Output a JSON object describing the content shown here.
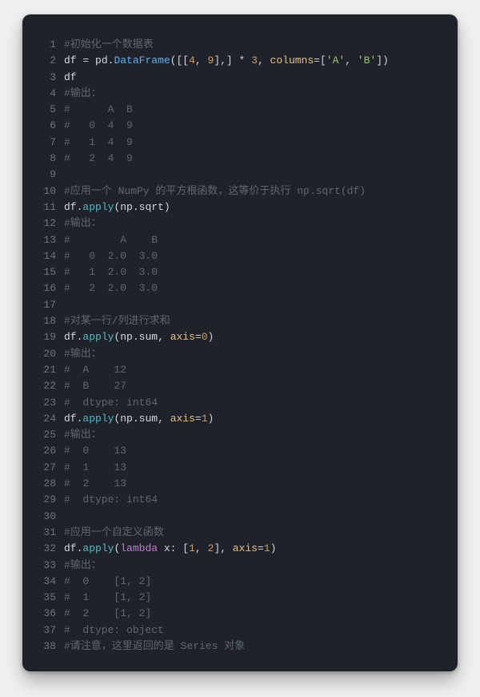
{
  "theme": {
    "background": "#1f2329",
    "gutter": "#6c7380",
    "foreground": "#d4d8df",
    "comment": "#5e6672",
    "function": "#61afef",
    "attribute": "#56b6c2",
    "number": "#d19a66",
    "string": "#98c379",
    "keyword": "#c678dd",
    "parameter": "#e5c07b"
  },
  "lines": [
    {
      "n": 1,
      "tokens": [
        [
          "c-comment",
          "#初始化一个数据表"
        ]
      ]
    },
    {
      "n": 2,
      "tokens": [
        [
          "c-ident",
          "df "
        ],
        [
          "c-op",
          "= "
        ],
        [
          "c-ident",
          "pd"
        ],
        [
          "c-op",
          "."
        ],
        [
          "c-func",
          "DataFrame"
        ],
        [
          "c-op",
          "([["
        ],
        [
          "c-num",
          "4"
        ],
        [
          "c-op",
          ", "
        ],
        [
          "c-num",
          "9"
        ],
        [
          "c-op",
          "],] "
        ],
        [
          "c-op",
          "* "
        ],
        [
          "c-num",
          "3"
        ],
        [
          "c-op",
          ", "
        ],
        [
          "c-param",
          "columns"
        ],
        [
          "c-op",
          "=["
        ],
        [
          "c-str",
          "'A'"
        ],
        [
          "c-op",
          ", "
        ],
        [
          "c-str",
          "'B'"
        ],
        [
          "c-op",
          "])"
        ]
      ]
    },
    {
      "n": 3,
      "tokens": [
        [
          "c-ident",
          "df"
        ]
      ]
    },
    {
      "n": 4,
      "tokens": [
        [
          "c-comment",
          "#输出："
        ]
      ]
    },
    {
      "n": 5,
      "tokens": [
        [
          "c-comment",
          "#      A  B"
        ]
      ]
    },
    {
      "n": 6,
      "tokens": [
        [
          "c-comment",
          "#   0  4  9"
        ]
      ]
    },
    {
      "n": 7,
      "tokens": [
        [
          "c-comment",
          "#   1  4  9"
        ]
      ]
    },
    {
      "n": 8,
      "tokens": [
        [
          "c-comment",
          "#   2  4  9"
        ]
      ]
    },
    {
      "n": 9,
      "tokens": []
    },
    {
      "n": 10,
      "tokens": [
        [
          "c-comment",
          "#应用一个 NumPy 的平方根函数，这等价于执行 np.sqrt(df)"
        ]
      ]
    },
    {
      "n": 11,
      "tokens": [
        [
          "c-ident",
          "df"
        ],
        [
          "c-op",
          "."
        ],
        [
          "c-attr",
          "apply"
        ],
        [
          "c-op",
          "("
        ],
        [
          "c-ident",
          "np"
        ],
        [
          "c-op",
          "."
        ],
        [
          "c-ident",
          "sqrt"
        ],
        [
          "c-op",
          ")"
        ]
      ]
    },
    {
      "n": 12,
      "tokens": [
        [
          "c-comment",
          "#输出："
        ]
      ]
    },
    {
      "n": 13,
      "tokens": [
        [
          "c-comment",
          "#        A    B"
        ]
      ]
    },
    {
      "n": 14,
      "tokens": [
        [
          "c-comment",
          "#   0  2.0  3.0"
        ]
      ]
    },
    {
      "n": 15,
      "tokens": [
        [
          "c-comment",
          "#   1  2.0  3.0"
        ]
      ]
    },
    {
      "n": 16,
      "tokens": [
        [
          "c-comment",
          "#   2  2.0  3.0"
        ]
      ]
    },
    {
      "n": 17,
      "tokens": []
    },
    {
      "n": 18,
      "tokens": [
        [
          "c-comment",
          "#对某一行/列进行求和"
        ]
      ]
    },
    {
      "n": 19,
      "tokens": [
        [
          "c-ident",
          "df"
        ],
        [
          "c-op",
          "."
        ],
        [
          "c-attr",
          "apply"
        ],
        [
          "c-op",
          "("
        ],
        [
          "c-ident",
          "np"
        ],
        [
          "c-op",
          "."
        ],
        [
          "c-ident",
          "sum"
        ],
        [
          "c-op",
          ", "
        ],
        [
          "c-param",
          "axis"
        ],
        [
          "c-op",
          "="
        ],
        [
          "c-num",
          "0"
        ],
        [
          "c-op",
          ")"
        ]
      ]
    },
    {
      "n": 20,
      "tokens": [
        [
          "c-comment",
          "#输出："
        ]
      ]
    },
    {
      "n": 21,
      "tokens": [
        [
          "c-comment",
          "#  A    12"
        ]
      ]
    },
    {
      "n": 22,
      "tokens": [
        [
          "c-comment",
          "#  B    27"
        ]
      ]
    },
    {
      "n": 23,
      "tokens": [
        [
          "c-comment",
          "#  dtype: int64"
        ]
      ]
    },
    {
      "n": 24,
      "tokens": [
        [
          "c-ident",
          "df"
        ],
        [
          "c-op",
          "."
        ],
        [
          "c-attr",
          "apply"
        ],
        [
          "c-op",
          "("
        ],
        [
          "c-ident",
          "np"
        ],
        [
          "c-op",
          "."
        ],
        [
          "c-ident",
          "sum"
        ],
        [
          "c-op",
          ", "
        ],
        [
          "c-param",
          "axis"
        ],
        [
          "c-op",
          "="
        ],
        [
          "c-num",
          "1"
        ],
        [
          "c-op",
          ")"
        ]
      ]
    },
    {
      "n": 25,
      "tokens": [
        [
          "c-comment",
          "#输出："
        ]
      ]
    },
    {
      "n": 26,
      "tokens": [
        [
          "c-comment",
          "#  0    13"
        ]
      ]
    },
    {
      "n": 27,
      "tokens": [
        [
          "c-comment",
          "#  1    13"
        ]
      ]
    },
    {
      "n": 28,
      "tokens": [
        [
          "c-comment",
          "#  2    13"
        ]
      ]
    },
    {
      "n": 29,
      "tokens": [
        [
          "c-comment",
          "#  dtype: int64"
        ]
      ]
    },
    {
      "n": 30,
      "tokens": []
    },
    {
      "n": 31,
      "tokens": [
        [
          "c-comment",
          "#应用一个自定义函数"
        ]
      ]
    },
    {
      "n": 32,
      "tokens": [
        [
          "c-ident",
          "df"
        ],
        [
          "c-op",
          "."
        ],
        [
          "c-attr",
          "apply"
        ],
        [
          "c-op",
          "("
        ],
        [
          "c-kw",
          "lambda"
        ],
        [
          "c-ident",
          " x"
        ],
        [
          "c-op",
          ": ["
        ],
        [
          "c-num",
          "1"
        ],
        [
          "c-op",
          ", "
        ],
        [
          "c-num",
          "2"
        ],
        [
          "c-op",
          "], "
        ],
        [
          "c-param",
          "axis"
        ],
        [
          "c-op",
          "="
        ],
        [
          "c-num",
          "1"
        ],
        [
          "c-op",
          ")"
        ]
      ]
    },
    {
      "n": 33,
      "tokens": [
        [
          "c-comment",
          "#输出："
        ]
      ]
    },
    {
      "n": 34,
      "tokens": [
        [
          "c-comment",
          "#  0    [1, 2]"
        ]
      ]
    },
    {
      "n": 35,
      "tokens": [
        [
          "c-comment",
          "#  1    [1, 2]"
        ]
      ]
    },
    {
      "n": 36,
      "tokens": [
        [
          "c-comment",
          "#  2    [1, 2]"
        ]
      ]
    },
    {
      "n": 37,
      "tokens": [
        [
          "c-comment",
          "#  dtype: object"
        ]
      ]
    },
    {
      "n": 38,
      "tokens": [
        [
          "c-comment",
          "#请注意，这里返回的是 Series 对象"
        ]
      ]
    }
  ]
}
